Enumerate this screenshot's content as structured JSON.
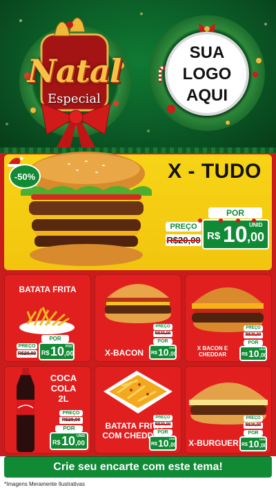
{
  "header": {
    "title": "Natal",
    "subtitle": "Especial",
    "logo_placeholder": "SUA\nLOGO\nAQUI"
  },
  "featured": {
    "discount": "-50%",
    "name": "X - TUDO",
    "preco_label": "PREÇO",
    "old_price": "R$20,00",
    "por_label": "POR",
    "currency": "R$",
    "price_int": "10",
    "price_dec": ",00",
    "unit": "UNID"
  },
  "products": [
    {
      "name": "BATATA FRITA",
      "preco_label": "PREÇO",
      "old_price": "R$20,00",
      "por_label": "POR",
      "currency": "R$",
      "price_int": "10",
      "price_dec": ",00",
      "unit": "POC"
    },
    {
      "name": "X-BACON",
      "preco_label": "PREÇO",
      "old_price": "R$20,00",
      "por_label": "POR",
      "currency": "R$",
      "price_int": "10",
      "price_dec": ",00",
      "unit": "UNID"
    },
    {
      "name": "X BACON E CHEDDAR",
      "preco_label": "PREÇO",
      "old_price": "R$20,00",
      "por_label": "POR",
      "currency": "R$",
      "price_int": "10",
      "price_dec": ",00",
      "unit": "UNID"
    },
    {
      "name": "COCA COLA 2L",
      "preco_label": "PREÇO",
      "old_price": "R$20,00",
      "por_label": "POR",
      "currency": "R$",
      "price_int": "10",
      "price_dec": ",00",
      "unit": "UNID"
    },
    {
      "name": "BATATA FRITA COM CHEDDAR",
      "preco_label": "PREÇO",
      "old_price": "R$20,00",
      "por_label": "POR",
      "currency": "R$",
      "price_int": "10",
      "price_dec": ",00",
      "unit": "UNID"
    },
    {
      "name": "X-BURGUER",
      "preco_label": "PREÇO",
      "old_price": "R$20,00",
      "por_label": "POR",
      "currency": "R$",
      "price_int": "10",
      "price_dec": ",00",
      "unit": "UNID"
    }
  ],
  "footer": {
    "cta": "Crie seu encarte com este tema!",
    "disclaimer": "*Imagens Meramente Ilustrativas"
  },
  "colors": {
    "header_green": "#0b5a26",
    "body_red": "#c91c1c",
    "featured_yellow": "#f5cd12",
    "price_green": "#118a35",
    "title_gold": "#f7c244"
  },
  "icons": [
    "wreath-icon",
    "bells-icon",
    "bow-icon",
    "ornament-icon",
    "candy-cane-icon",
    "santa-hat-icon",
    "hamburger-image",
    "fries-image",
    "soda-bottle-image"
  ]
}
